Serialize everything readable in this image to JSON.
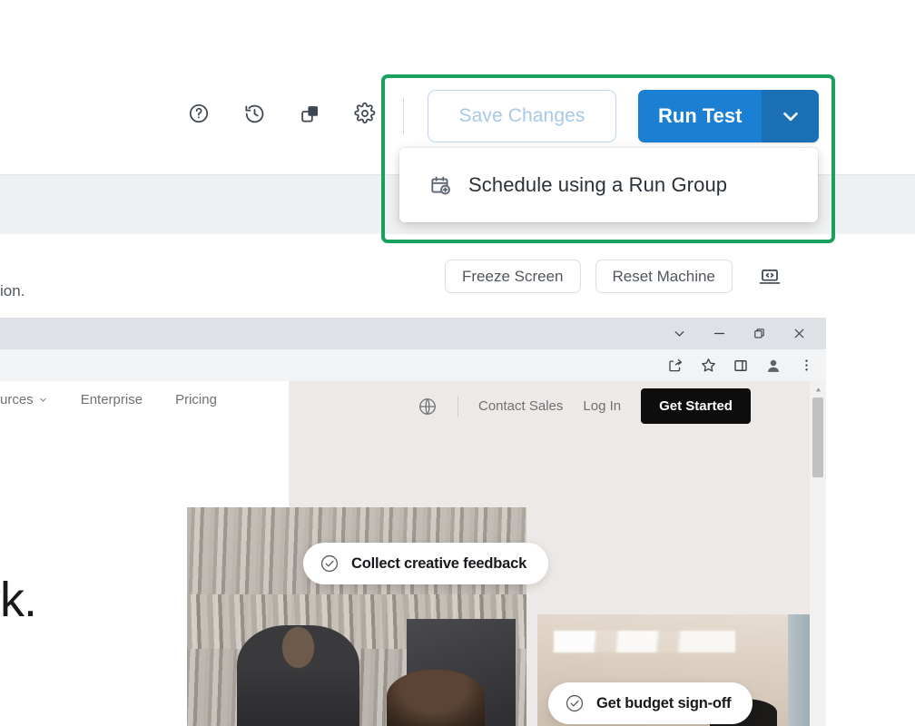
{
  "app_toolbar": {
    "icons": [
      {
        "name": "help-icon",
        "title": "Help"
      },
      {
        "name": "history-icon",
        "title": "History"
      },
      {
        "name": "duplicate-icon",
        "title": "Duplicate"
      },
      {
        "name": "settings-gear-icon",
        "title": "Settings"
      }
    ],
    "save_label": "Save Changes",
    "run_label": "Run Test",
    "run_caret_name": "chevron-down-icon"
  },
  "dropdown": {
    "items": [
      {
        "icon": "calendar-plus-icon",
        "label": "Schedule using a Run Group"
      }
    ]
  },
  "machine_bar": {
    "clipped_description": "ion.",
    "freeze_label": "Freeze Screen",
    "reset_label": "Reset Machine",
    "code_icon_name": "laptop-code-icon"
  },
  "browser": {
    "window_controls": [
      {
        "name": "chevron-down-icon",
        "glyph": "v"
      },
      {
        "name": "minimize-icon",
        "glyph": "–"
      },
      {
        "name": "restore-icon",
        "glyph": "❐"
      },
      {
        "name": "close-icon",
        "glyph": "✕"
      }
    ],
    "toolbar_icons": [
      {
        "name": "share-icon"
      },
      {
        "name": "bookmark-star-icon"
      },
      {
        "name": "side-panel-icon"
      },
      {
        "name": "profile-avatar-icon"
      },
      {
        "name": "kebab-menu-icon"
      }
    ]
  },
  "site": {
    "nav_left": [
      {
        "label": "urces",
        "has_caret": true
      },
      {
        "label": "Enterprise",
        "has_caret": false
      },
      {
        "label": "Pricing",
        "has_caret": false
      }
    ],
    "nav_right": {
      "globe_icon": "globe-icon",
      "contact_label": "Contact Sales",
      "login_label": "Log In",
      "cta_label": "Get Started"
    },
    "hero_heading_clipped": "ork.",
    "pills": [
      {
        "label": "Collect creative feedback",
        "icon": "check-circle-icon"
      },
      {
        "label": "Get budget sign-off",
        "icon": "check-circle-icon"
      }
    ]
  },
  "colors": {
    "highlight_green": "#17a05e",
    "primary_blue": "#1b7fd4",
    "primary_blue_dark": "#1a6fb5",
    "save_border_blue": "#bdd7ef",
    "save_text_blue": "#a8c8e8",
    "cta_black": "#0d0d0d",
    "grey_band": "#eff0f1",
    "browser_titlebar": "#dee1e6",
    "browser_toolbar": "#f1f3f4",
    "hero_bg": "#ece9e6"
  }
}
